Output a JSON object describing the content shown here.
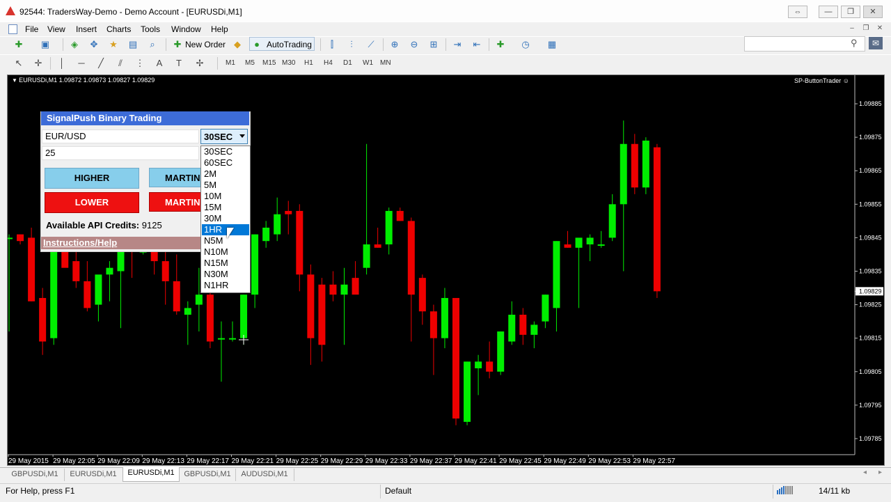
{
  "window": {
    "title": "92544: TradersWay-Demo - Demo Account - [EURUSDi,M1]",
    "controls": [
      "⇔",
      "—",
      "❐",
      "✕"
    ]
  },
  "menu": [
    "File",
    "View",
    "Insert",
    "Charts",
    "Tools",
    "Window",
    "Help"
  ],
  "mdi_controls": [
    "–",
    "❐",
    "✕"
  ],
  "toolbar": {
    "new_order": "New Order",
    "autotrading": "AutoTrading",
    "search_placeholder": ""
  },
  "timeframes": [
    "M1",
    "M5",
    "M15",
    "M30",
    "H1",
    "H4",
    "D1",
    "W1",
    "MN"
  ],
  "chart": {
    "symbol_line": "EURUSDi,M1  1.09872 1.09873 1.09827 1.09829",
    "indicator_name": "SP-ButtonTrader",
    "price_labels": [
      "1.09885",
      "1.09875",
      "1.09865",
      "1.09855",
      "1.09845",
      "1.09835",
      "1.09829",
      "1.09825",
      "1.09815",
      "1.09805",
      "1.09795",
      "1.09785"
    ],
    "time_labels": [
      "29 May 2015",
      "29 May 22:05",
      "29 May 22:09",
      "29 May 22:13",
      "29 May 22:17",
      "29 May 22:21",
      "29 May 22:25",
      "29 May 22:29",
      "29 May 22:33",
      "29 May 22:37",
      "29 May 22:41",
      "29 May 22:45",
      "29 May 22:49",
      "29 May 22:53",
      "29 May 22:57"
    ],
    "colors": {
      "background": "#000000",
      "bull": "#00ee00",
      "bear": "#ee0000",
      "axis_text": "#ffffff"
    }
  },
  "chart_data": {
    "type": "candlestick",
    "ylim": [
      1.0978,
      1.0989
    ],
    "bull_color": "#00ee00",
    "bear_color": "#ee0000",
    "candles": [
      {
        "o": 1.09845,
        "h": 1.09846,
        "l": 1.09817,
        "c": 1.09845
      },
      {
        "o": 1.09846,
        "h": 1.09846,
        "l": 1.09843,
        "c": 1.09844
      },
      {
        "o": 1.09845,
        "h": 1.09848,
        "l": 1.09826,
        "c": 1.09826
      },
      {
        "o": 1.09827,
        "h": 1.0983,
        "l": 1.0981,
        "c": 1.09814
      },
      {
        "o": 1.09815,
        "h": 1.09847,
        "l": 1.09813,
        "c": 1.09847
      },
      {
        "o": 1.09847,
        "h": 1.0985,
        "l": 1.0984,
        "c": 1.09836
      },
      {
        "o": 1.09838,
        "h": 1.09842,
        "l": 1.0983,
        "c": 1.09832
      },
      {
        "o": 1.09832,
        "h": 1.09838,
        "l": 1.09823,
        "c": 1.09824
      },
      {
        "o": 1.09825,
        "h": 1.09833,
        "l": 1.0982,
        "c": 1.09834
      },
      {
        "o": 1.09834,
        "h": 1.09838,
        "l": 1.09826,
        "c": 1.09836
      },
      {
        "o": 1.09835,
        "h": 1.09842,
        "l": 1.09818,
        "c": 1.09843
      },
      {
        "o": 1.09842,
        "h": 1.09843,
        "l": 1.09833,
        "c": 1.09841
      },
      {
        "o": 1.09841,
        "h": 1.09845,
        "l": 1.0984,
        "c": 1.09841
      },
      {
        "o": 1.09841,
        "h": 1.09845,
        "l": 1.09834,
        "c": 1.09838
      },
      {
        "o": 1.09838,
        "h": 1.09845,
        "l": 1.09825,
        "c": 1.09832
      },
      {
        "o": 1.09832,
        "h": 1.0984,
        "l": 1.09822,
        "c": 1.09823
      },
      {
        "o": 1.09822,
        "h": 1.09826,
        "l": 1.09813,
        "c": 1.09824
      },
      {
        "o": 1.09825,
        "h": 1.09836,
        "l": 1.09817,
        "c": 1.09828
      },
      {
        "o": 1.09828,
        "h": 1.09835,
        "l": 1.09812,
        "c": 1.09814
      },
      {
        "o": 1.09815,
        "h": 1.0982,
        "l": 1.09802,
        "c": 1.09815
      },
      {
        "o": 1.09815,
        "h": 1.0982,
        "l": 1.09814,
        "c": 1.09815
      },
      {
        "o": 1.09815,
        "h": 1.09828,
        "l": 1.09813,
        "c": 1.09828
      },
      {
        "o": 1.09828,
        "h": 1.09846,
        "l": 1.09824,
        "c": 1.09846
      },
      {
        "o": 1.09844,
        "h": 1.0985,
        "l": 1.09842,
        "c": 1.09848
      },
      {
        "o": 1.09846,
        "h": 1.09857,
        "l": 1.09844,
        "c": 1.09852
      },
      {
        "o": 1.09853,
        "h": 1.09856,
        "l": 1.09846,
        "c": 1.09852
      },
      {
        "o": 1.09853,
        "h": 1.09855,
        "l": 1.09829,
        "c": 1.09834
      },
      {
        "o": 1.09834,
        "h": 1.09837,
        "l": 1.09807,
        "c": 1.09815
      },
      {
        "o": 1.09831,
        "h": 1.09833,
        "l": 1.09808,
        "c": 1.09813
      },
      {
        "o": 1.09831,
        "h": 1.09835,
        "l": 1.09826,
        "c": 1.09828
      },
      {
        "o": 1.09828,
        "h": 1.09836,
        "l": 1.09813,
        "c": 1.09831
      },
      {
        "o": 1.09833,
        "h": 1.09838,
        "l": 1.0983,
        "c": 1.09828
      },
      {
        "o": 1.09836,
        "h": 1.09873,
        "l": 1.09834,
        "c": 1.09843
      },
      {
        "o": 1.09843,
        "h": 1.09848,
        "l": 1.09842,
        "c": 1.09842
      },
      {
        "o": 1.09843,
        "h": 1.09854,
        "l": 1.0984,
        "c": 1.09853
      },
      {
        "o": 1.09853,
        "h": 1.09854,
        "l": 1.0985,
        "c": 1.0985
      },
      {
        "o": 1.0985,
        "h": 1.09851,
        "l": 1.09814,
        "c": 1.09828
      },
      {
        "o": 1.09833,
        "h": 1.09834,
        "l": 1.09819,
        "c": 1.09823
      },
      {
        "o": 1.09823,
        "h": 1.09825,
        "l": 1.09804,
        "c": 1.09815
      },
      {
        "o": 1.09815,
        "h": 1.0983,
        "l": 1.09812,
        "c": 1.09827
      },
      {
        "o": 1.09827,
        "h": 1.09827,
        "l": 1.09789,
        "c": 1.09791
      },
      {
        "o": 1.0979,
        "h": 1.09808,
        "l": 1.09789,
        "c": 1.09808
      },
      {
        "o": 1.09806,
        "h": 1.0981,
        "l": 1.09798,
        "c": 1.09808
      },
      {
        "o": 1.09808,
        "h": 1.09814,
        "l": 1.09803,
        "c": 1.09805
      },
      {
        "o": 1.09805,
        "h": 1.09817,
        "l": 1.09804,
        "c": 1.09817
      },
      {
        "o": 1.09814,
        "h": 1.09826,
        "l": 1.09813,
        "c": 1.09822
      },
      {
        "o": 1.09822,
        "h": 1.09824,
        "l": 1.09813,
        "c": 1.09816
      },
      {
        "o": 1.09816,
        "h": 1.0982,
        "l": 1.09812,
        "c": 1.09819
      },
      {
        "o": 1.0982,
        "h": 1.09828,
        "l": 1.09818,
        "c": 1.09828
      },
      {
        "o": 1.09824,
        "h": 1.09844,
        "l": 1.09817,
        "c": 1.09844
      },
      {
        "o": 1.09843,
        "h": 1.09847,
        "l": 1.09842,
        "c": 1.09842
      },
      {
        "o": 1.09842,
        "h": 1.09844,
        "l": 1.09824,
        "c": 1.09845
      },
      {
        "o": 1.09843,
        "h": 1.09846,
        "l": 1.09838,
        "c": 1.09845
      },
      {
        "o": 1.09843,
        "h": 1.09847,
        "l": 1.09842,
        "c": 1.09843
      },
      {
        "o": 1.09845,
        "h": 1.09858,
        "l": 1.09844,
        "c": 1.09855
      },
      {
        "o": 1.09855,
        "h": 1.0988,
        "l": 1.09835,
        "c": 1.09873
      },
      {
        "o": 1.09873,
        "h": 1.09876,
        "l": 1.09858,
        "c": 1.0986
      },
      {
        "o": 1.0986,
        "h": 1.09875,
        "l": 1.09858,
        "c": 1.09874
      },
      {
        "o": 1.09872,
        "h": 1.09873,
        "l": 1.09827,
        "c": 1.09829
      }
    ]
  },
  "panel": {
    "title": "SignalPush Binary Trading",
    "pair": "EUR/USD",
    "amount": "25",
    "higher": "HIGHER",
    "lower": "LOWER",
    "martin_top": "MARTIN",
    "martin_bottom": "MARTIN",
    "credits_label": "Available API Credits:",
    "credits_value": "9125",
    "help": "Instructions/Help",
    "colors": {
      "title_bg": "#3d6cd8",
      "higher_bg": "#87ceeb",
      "lower_bg": "#ee1111",
      "help_bg": "#b78786"
    }
  },
  "dropdown": {
    "selected": "30SEC",
    "options": [
      "30SEC",
      "60SEC",
      "2M",
      "5M",
      "10M",
      "15M",
      "30M",
      "1HR",
      "N5M",
      "N10M",
      "N15M",
      "N30M",
      "N1HR"
    ],
    "highlighted": "1HR"
  },
  "tabs": [
    "GBPUSDi,M1",
    "EURUSDi,M1",
    "EURUSDi,M1",
    "GBPUSDi,M1",
    "AUDUSDi,M1"
  ],
  "tab_scroll": [
    "◂",
    "▸"
  ],
  "status": {
    "help": "For Help, press F1",
    "profile": "Default",
    "traffic": "14/11 kb"
  }
}
